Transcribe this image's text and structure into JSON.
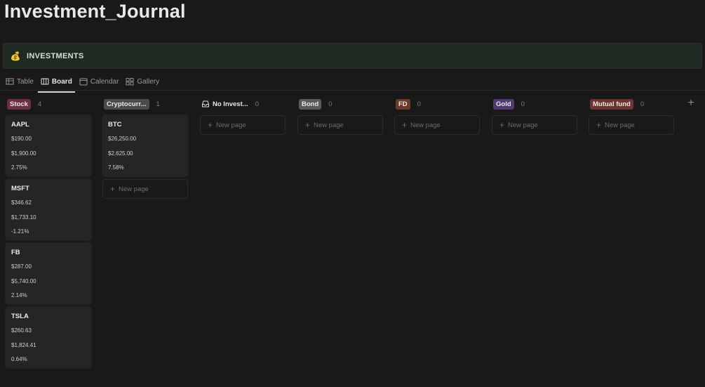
{
  "page": {
    "title": "Investment_Journal"
  },
  "callout": {
    "icon": "money-bag-icon",
    "emoji": "💰",
    "title": "INVESTMENTS"
  },
  "views": [
    {
      "label": "Table",
      "icon": "table-icon",
      "active": false
    },
    {
      "label": "Board",
      "icon": "board-icon",
      "active": true
    },
    {
      "label": "Calendar",
      "icon": "calendar-icon",
      "active": false
    },
    {
      "label": "Gallery",
      "icon": "gallery-icon",
      "active": false
    }
  ],
  "board": {
    "new_page_label": "New page",
    "columns": [
      {
        "name": "Stock",
        "count": "4",
        "color": "#6e2f45",
        "cards": [
          {
            "title": "AAPL",
            "price": "$190.00",
            "total": "$1,900.00",
            "change": "2.75%"
          },
          {
            "title": "MSFT",
            "price": "$346.62",
            "total": "$1,733.10",
            "change": "-1.21%"
          },
          {
            "title": "FB",
            "price": "$287.00",
            "total": "$5,740.00",
            "change": "2.14%"
          },
          {
            "title": "TSLA",
            "price": "$260.63",
            "total": "$1,824.41",
            "change": "0.64%"
          }
        ]
      },
      {
        "name": "Cryptocurr...",
        "count": "1",
        "color": "#4b4b4b",
        "cards": [
          {
            "title": "BTC",
            "price": "$26,250.00",
            "total": "$2,625.00",
            "change": "7.58%"
          }
        ]
      },
      {
        "name": "No Invest...",
        "count": "0",
        "color": "",
        "icon": "inbox-icon",
        "cards": []
      },
      {
        "name": "Bond",
        "count": "0",
        "color": "#5a5a5a",
        "cards": []
      },
      {
        "name": "FD",
        "count": "0",
        "color": "#6a3a2a",
        "cards": []
      },
      {
        "name": "Gold",
        "count": "0",
        "color": "#4f3970",
        "cards": []
      },
      {
        "name": "Mutual fund",
        "count": "0",
        "color": "#6e3430",
        "cards": []
      }
    ],
    "add_group_icon": "plus-icon"
  }
}
